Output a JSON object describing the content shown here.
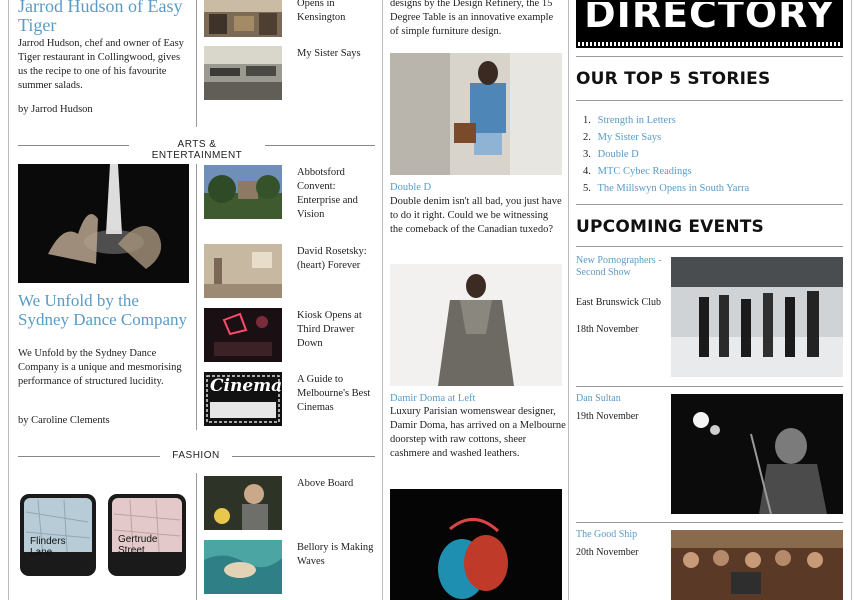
{
  "col1": {
    "lead_title": "Jarrod Hudson of Easy Tiger",
    "lead_body": "Jarrod Hudson, chef and owner of Easy Tiger restaurant in Collingwood, gives us the recipe to one of his favourite summer salads.",
    "lead_byline": "by Jarrod Hudson",
    "top_side_items": [
      "Opens in Kensington",
      "My Sister Says"
    ],
    "arts_section_label": "ARTS & ENTERTAINMENT",
    "arts_lead_title": "We Unfold by the Sydney Dance Company",
    "arts_lead_body": "We Unfold by the Sydney Dance Company is a unique and mesmorising performance of structured lucidity.",
    "arts_lead_byline": "by Caroline Clements",
    "arts_side_items": [
      "Abbotsford Convent: Enterprise and Vision",
      "David Rosetsky: (heart) Forever",
      "Kiosk Opens at Third Drawer Down",
      "A Guide to Melbourne's Best Cinemas"
    ],
    "fashion_section_label": "FASHION",
    "fashion_maps": [
      "Flinders Lane",
      "Gertrude Street"
    ],
    "fashion_side_items": [
      "Above Board",
      "Bellory is Making Waves"
    ],
    "cinema_sign_text": "Cinema"
  },
  "col2": {
    "intro_text": "designs by the Design Refinery, the 15 Degree Table is an innovative example of simple furniture design.",
    "story1_title": "Double D",
    "story1_body": "Double denim isn't all bad, you just have to do it right. Could we be witnessing the comeback of the Canadian tuxedo?",
    "story2_title": "Damir Doma at Left",
    "story2_body": "Luxury Parisian womenswear designer, Damir Doma, has arrived on a Melbourne doorstep with raw cottons, sheer cashmere and washed leathers."
  },
  "col3": {
    "directory_banner": "DIRECTORY",
    "top5_heading": "OUR TOP 5 STORIES",
    "top5": [
      {
        "num": "1.",
        "label": "Strength in Letters"
      },
      {
        "num": "2.",
        "label": "My Sister Says"
      },
      {
        "num": "3.",
        "label": "Double D"
      },
      {
        "num": "4.",
        "label": "MTC Cybec Readings"
      },
      {
        "num": "5.",
        "label": "The Millswyn Opens in South Yarra"
      }
    ],
    "events_heading": "UPCOMING EVENTS",
    "events": [
      {
        "title": "New Pornographers - Second Show",
        "venue": "East Brunswick Club",
        "date": "18th November"
      },
      {
        "title": "Dan Sultan",
        "venue": "",
        "date": "19th November"
      },
      {
        "title": "The Good Ship",
        "venue": "",
        "date": "20th November"
      }
    ]
  },
  "colors": {
    "link": "#5a9bc6",
    "rule": "#888888",
    "text": "#222222"
  }
}
